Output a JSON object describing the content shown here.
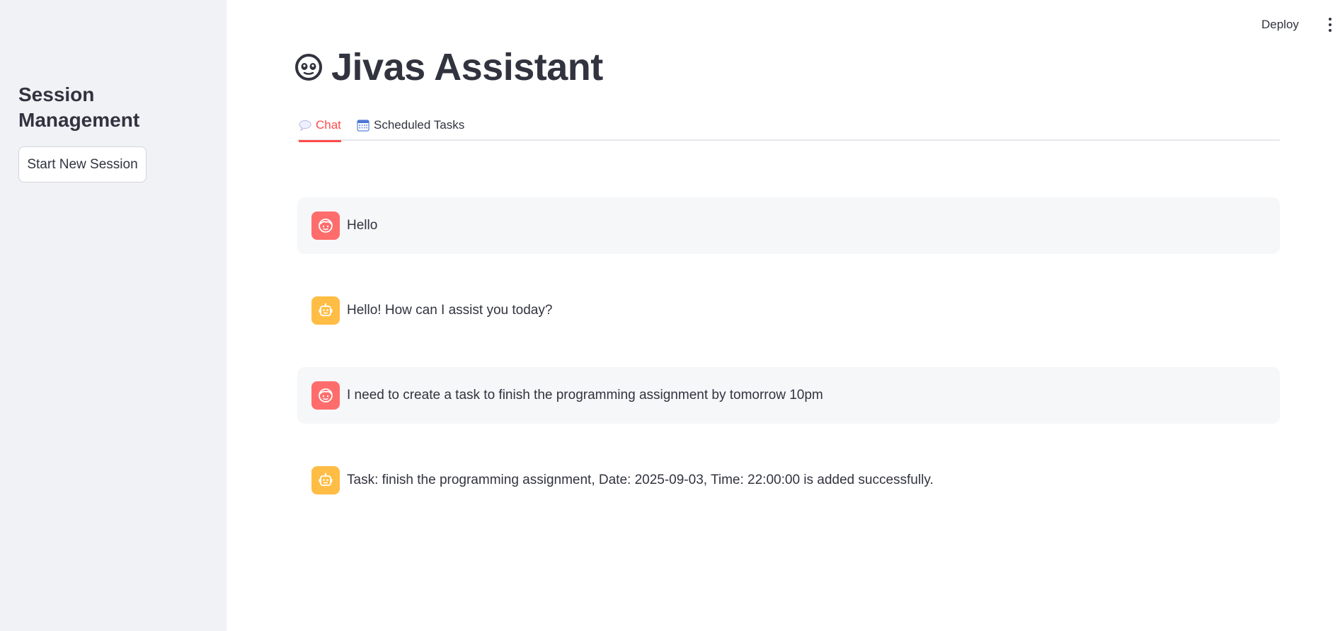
{
  "sidebar": {
    "title": "Session Management",
    "new_session_label": "Start New Session"
  },
  "toolbar": {
    "deploy_label": "Deploy"
  },
  "header": {
    "title": "Jivas Assistant"
  },
  "tabs": [
    {
      "label": "Chat",
      "icon": "speech-bubble-icon",
      "active": true
    },
    {
      "label": "Scheduled Tasks",
      "icon": "calendar-icon",
      "active": false
    }
  ],
  "messages": [
    {
      "role": "user",
      "text": "Hello"
    },
    {
      "role": "assistant",
      "text": "Hello! How can I assist you today?"
    },
    {
      "role": "user",
      "text": "I need to create a task to finish the programming assignment by tomorrow 10pm"
    },
    {
      "role": "assistant",
      "text": "Task: finish the programming assignment, Date: 2025-09-03, Time: 22:00:00 is added successfully."
    }
  ],
  "colors": {
    "accent": "#ff4b4b",
    "user_avatar": "#ff6c6c",
    "assistant_avatar": "#ffbd45",
    "sidebar_bg": "#f0f2f6"
  }
}
